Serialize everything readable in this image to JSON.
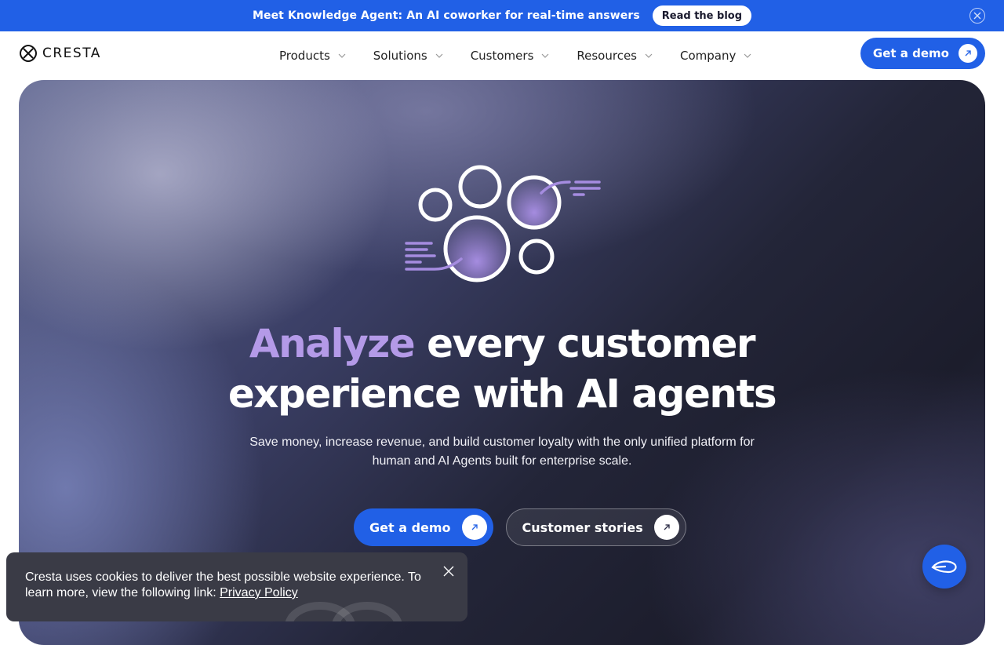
{
  "announcement": {
    "text": "Meet Knowledge Agent: An AI coworker for real-time answers",
    "button": "Read the blog",
    "close_icon": "close-icon"
  },
  "nav": {
    "logo": "CRESTA",
    "menu": [
      {
        "label": "Products"
      },
      {
        "label": "Solutions"
      },
      {
        "label": "Customers"
      },
      {
        "label": "Resources"
      },
      {
        "label": "Company"
      }
    ],
    "cta": "Get a demo"
  },
  "hero": {
    "headline_accent": "Analyze",
    "headline_rest_1": " every customer",
    "headline_line_2": "experience with AI agents",
    "subtitle_line_1": "Save money, increase revenue, and build customer loyalty with the only unified platform for",
    "subtitle_line_2": "human and AI Agents built for enterprise scale.",
    "primary_cta": "Get a demo",
    "secondary_cta": "Customer stories"
  },
  "cookie": {
    "text": "Cresta uses cookies to deliver the best possible website experience. To learn more, view the following link: ",
    "link": "Privacy Policy"
  },
  "chat": {
    "icon": "chat-icon"
  },
  "colors": {
    "brand_blue": "#2160e6",
    "accent_purple": "#b49ae8",
    "cookie_bg": "#3a3b46"
  }
}
